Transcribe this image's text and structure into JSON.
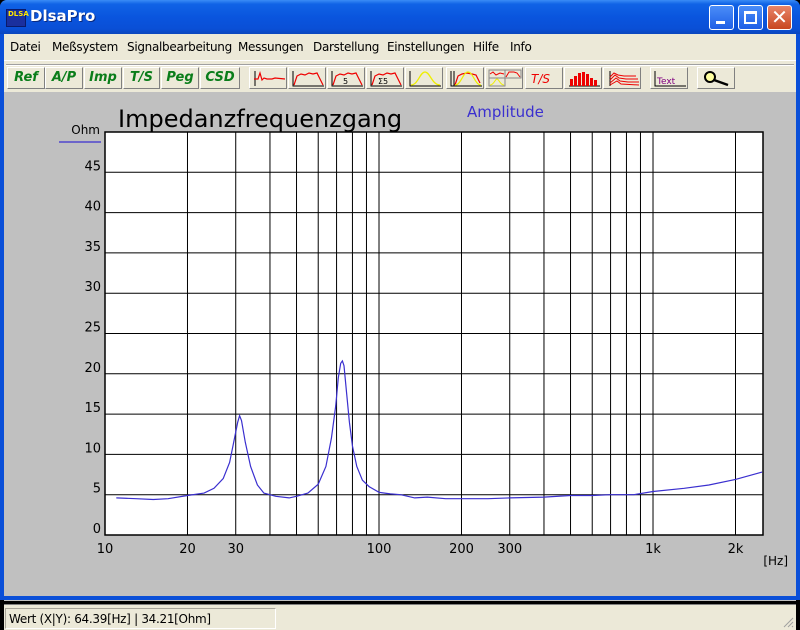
{
  "window": {
    "title": "DlsaPro",
    "app_icon_text": "DLSA",
    "buttons": {
      "minimize": "minimize",
      "maximize": "maximize",
      "close": "close"
    }
  },
  "menu": {
    "items": [
      {
        "label": "Datei"
      },
      {
        "label": "Meßsystem"
      },
      {
        "label": "Signalbearbeitung"
      },
      {
        "label": "Messungen"
      },
      {
        "label": "Darstellung"
      },
      {
        "label": "Einstellungen"
      },
      {
        "label": "Hilfe"
      },
      {
        "label": "Info"
      }
    ]
  },
  "toolbar": {
    "text_buttons": [
      {
        "label": "Ref"
      },
      {
        "label": "A/P"
      },
      {
        "label": "Imp"
      },
      {
        "label": "T/S"
      },
      {
        "label": "Peg"
      },
      {
        "label": "CSD"
      }
    ],
    "icon_buttons": [
      {
        "icon": "impulse-response-icon"
      },
      {
        "icon": "frequency-response-icon"
      },
      {
        "icon": "frequency-response-5-icon"
      },
      {
        "icon": "frequency-response-sum5-icon"
      },
      {
        "icon": "window-function-icon"
      },
      {
        "icon": "filter-overlay-icon"
      },
      {
        "icon": "multi-view-icon"
      },
      {
        "icon": "thiele-small-icon",
        "label": "T/S"
      },
      {
        "icon": "bar-spectrum-icon"
      },
      {
        "icon": "waterfall-icon"
      },
      {
        "icon": "text-icon",
        "label": "Text"
      },
      {
        "icon": "zoom-magnifier-icon"
      }
    ]
  },
  "chart_data": {
    "type": "line",
    "title": "Impedanzfrequenzgang",
    "legend": [
      {
        "name": "Amplitude",
        "color": "#3a2fcf"
      }
    ],
    "legend_placement": "top-center",
    "xlabel": "[Hz]",
    "ylabel": "Ohm",
    "x_scale": "log",
    "xlim": [
      10,
      2520
    ],
    "ylim": [
      0,
      50
    ],
    "grid": true,
    "x_ticks": [
      {
        "value": 10,
        "label": "10"
      },
      {
        "value": 20,
        "label": "20"
      },
      {
        "value": 30,
        "label": "30"
      },
      {
        "value": 100,
        "label": "100"
      },
      {
        "value": 200,
        "label": "200"
      },
      {
        "value": 300,
        "label": "300"
      },
      {
        "value": 1000,
        "label": "1k"
      },
      {
        "value": 2000,
        "label": "2k"
      }
    ],
    "x_gridlines": [
      20,
      30,
      40,
      50,
      60,
      70,
      80,
      90,
      100,
      200,
      300,
      400,
      500,
      600,
      700,
      800,
      900,
      1000,
      2000
    ],
    "y_ticks": [
      {
        "value": 0,
        "label": "0"
      },
      {
        "value": 5,
        "label": "5"
      },
      {
        "value": 10,
        "label": "10"
      },
      {
        "value": 15,
        "label": "15"
      },
      {
        "value": 20,
        "label": "20"
      },
      {
        "value": 25,
        "label": "25"
      },
      {
        "value": 30,
        "label": "30"
      },
      {
        "value": 35,
        "label": "35"
      },
      {
        "value": 40,
        "label": "40"
      },
      {
        "value": 45,
        "label": "45"
      }
    ],
    "series": [
      {
        "name": "Amplitude",
        "color": "#3a2fcf",
        "x": [
          11,
          13,
          15,
          17,
          20,
          23,
          25,
          27,
          28.5,
          29.5,
          30.5,
          31,
          31.5,
          32.5,
          34,
          36,
          38,
          42,
          47,
          50,
          55,
          60,
          64,
          67,
          69.5,
          71,
          72.5,
          73.5,
          74.5,
          76,
          78,
          80,
          83,
          87,
          92,
          100,
          110,
          120,
          135,
          150,
          175,
          200,
          250,
          300,
          400,
          500,
          600,
          700,
          850,
          1000,
          1300,
          1600,
          2000,
          2500
        ],
        "y": [
          4.6,
          4.5,
          4.4,
          4.5,
          4.9,
          5.2,
          5.8,
          7.0,
          9.0,
          11.5,
          14.0,
          14.8,
          14.2,
          11.5,
          8.5,
          6.2,
          5.2,
          4.8,
          4.6,
          4.8,
          5.2,
          6.3,
          8.5,
          12.0,
          16.0,
          19.5,
          21.3,
          21.6,
          21.0,
          18.0,
          14.0,
          11.0,
          8.5,
          6.8,
          6.0,
          5.3,
          5.1,
          5.0,
          4.6,
          4.7,
          4.5,
          4.5,
          4.5,
          4.6,
          4.7,
          4.9,
          4.9,
          5.0,
          5.0,
          5.4,
          5.8,
          6.2,
          6.9,
          7.8
        ]
      }
    ]
  },
  "status": {
    "text": "Wert (X|Y): 64.39[Hz] | 34.21[Ohm]"
  }
}
